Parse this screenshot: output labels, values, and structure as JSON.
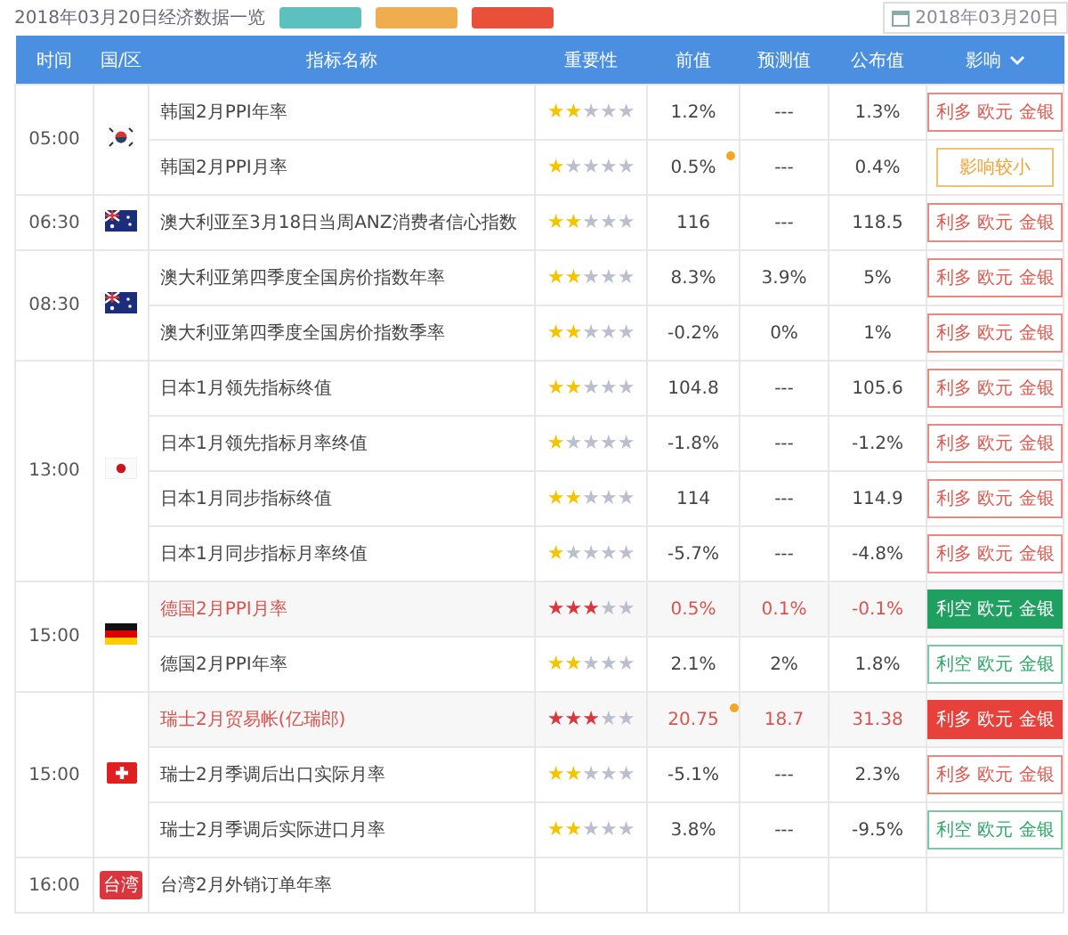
{
  "top_bar": {
    "title": "2018年03月20日经济数据一览",
    "filters": [
      {
        "color": "#5bc0be"
      },
      {
        "color": "#f0ad4e"
      },
      {
        "color": "#e8503a"
      }
    ],
    "date": "2018年03月20日"
  },
  "table": {
    "columns": [
      "时间",
      "国/区",
      "指标名称",
      "重要性",
      "前值",
      "预测值",
      "公布值",
      "影响"
    ],
    "groups": [
      {
        "time": "05:00",
        "flag": {
          "kind": "korea"
        },
        "events": [
          {
            "name": "韩国2月PPI年率",
            "important": false,
            "stars": 2,
            "previous": "1.2%",
            "revised": false,
            "forecast": "---",
            "actual": "1.3%",
            "impact": {
              "kind": "bullish",
              "filled": false,
              "text": "利多 欧元 金银"
            }
          },
          {
            "name": "韩国2月PPI月率",
            "important": false,
            "stars": 1,
            "previous": "0.5%",
            "revised": true,
            "forecast": "---",
            "actual": "0.4%",
            "impact": {
              "kind": "minor",
              "filled": false,
              "text": "影响较小"
            }
          }
        ]
      },
      {
        "time": "06:30",
        "flag": {
          "kind": "australia"
        },
        "events": [
          {
            "name": "澳大利亚至3月18日当周ANZ消费者信心指数",
            "important": false,
            "stars": 2,
            "previous": "116",
            "revised": false,
            "forecast": "---",
            "actual": "118.5",
            "impact": {
              "kind": "bullish",
              "filled": false,
              "text": "利多 欧元 金银"
            }
          }
        ]
      },
      {
        "time": "08:30",
        "flag": {
          "kind": "australia"
        },
        "events": [
          {
            "name": "澳大利亚第四季度全国房价指数年率",
            "important": false,
            "stars": 2,
            "previous": "8.3%",
            "revised": false,
            "forecast": "3.9%",
            "actual": "5%",
            "impact": {
              "kind": "bullish",
              "filled": false,
              "text": "利多 欧元 金银"
            }
          },
          {
            "name": "澳大利亚第四季度全国房价指数季率",
            "important": false,
            "stars": 2,
            "previous": "-0.2%",
            "revised": false,
            "forecast": "0%",
            "actual": "1%",
            "impact": {
              "kind": "bullish",
              "filled": false,
              "text": "利多 欧元 金银"
            }
          }
        ]
      },
      {
        "time": "13:00",
        "flag": {
          "kind": "japan"
        },
        "events": [
          {
            "name": "日本1月领先指标终值",
            "important": false,
            "stars": 2,
            "previous": "104.8",
            "revised": false,
            "forecast": "---",
            "actual": "105.6",
            "impact": {
              "kind": "bullish",
              "filled": false,
              "text": "利多 欧元 金银"
            }
          },
          {
            "name": "日本1月领先指标月率终值",
            "important": false,
            "stars": 1,
            "previous": "-1.8%",
            "revised": false,
            "forecast": "---",
            "actual": "-1.2%",
            "impact": {
              "kind": "bullish",
              "filled": false,
              "text": "利多 欧元 金银"
            }
          },
          {
            "name": "日本1月同步指标终值",
            "important": false,
            "stars": 2,
            "previous": "114",
            "revised": false,
            "forecast": "---",
            "actual": "114.9",
            "impact": {
              "kind": "bullish",
              "filled": false,
              "text": "利多 欧元 金银"
            }
          },
          {
            "name": "日本1月同步指标月率终值",
            "important": false,
            "stars": 1,
            "previous": "-5.7%",
            "revised": false,
            "forecast": "---",
            "actual": "-4.8%",
            "impact": {
              "kind": "bullish",
              "filled": false,
              "text": "利多 欧元 金银"
            }
          }
        ]
      },
      {
        "time": "15:00",
        "flag": {
          "kind": "germany"
        },
        "events": [
          {
            "name": "德国2月PPI月率",
            "important": true,
            "stars": 3,
            "previous": "0.5%",
            "revised": false,
            "forecast": "0.1%",
            "actual": "-0.1%",
            "impact": {
              "kind": "bearish",
              "filled": true,
              "text": "利空 欧元 金银"
            }
          },
          {
            "name": "德国2月PPI年率",
            "important": false,
            "stars": 2,
            "previous": "2.1%",
            "revised": false,
            "forecast": "2%",
            "actual": "1.8%",
            "impact": {
              "kind": "bearish",
              "filled": false,
              "text": "利空 欧元 金银"
            }
          }
        ]
      },
      {
        "time": "15:00",
        "flag": {
          "kind": "switzerland"
        },
        "events": [
          {
            "name": "瑞士2月贸易帐(亿瑞郎)",
            "important": true,
            "stars": 3,
            "previous": "20.75",
            "revised": true,
            "forecast": "18.7",
            "actual": "31.38",
            "impact": {
              "kind": "bullish",
              "filled": true,
              "text": "利多 欧元 金银"
            }
          },
          {
            "name": "瑞士2月季调后出口实际月率",
            "important": false,
            "stars": 2,
            "previous": "-5.1%",
            "revised": false,
            "forecast": "---",
            "actual": "2.3%",
            "impact": {
              "kind": "bullish",
              "filled": false,
              "text": "利多 欧元 金银"
            }
          },
          {
            "name": "瑞士2月季调后实际进口月率",
            "important": false,
            "stars": 2,
            "previous": "3.8%",
            "revised": false,
            "forecast": "---",
            "actual": "-9.5%",
            "impact": {
              "kind": "bearish",
              "filled": false,
              "text": "利空 欧元 金银"
            }
          }
        ]
      },
      {
        "time": "16:00",
        "flag": {
          "kind": "taiwan",
          "label": "台湾"
        },
        "events": [
          {
            "name": "台湾2月外销订单年率",
            "important": false
          }
        ]
      }
    ]
  }
}
